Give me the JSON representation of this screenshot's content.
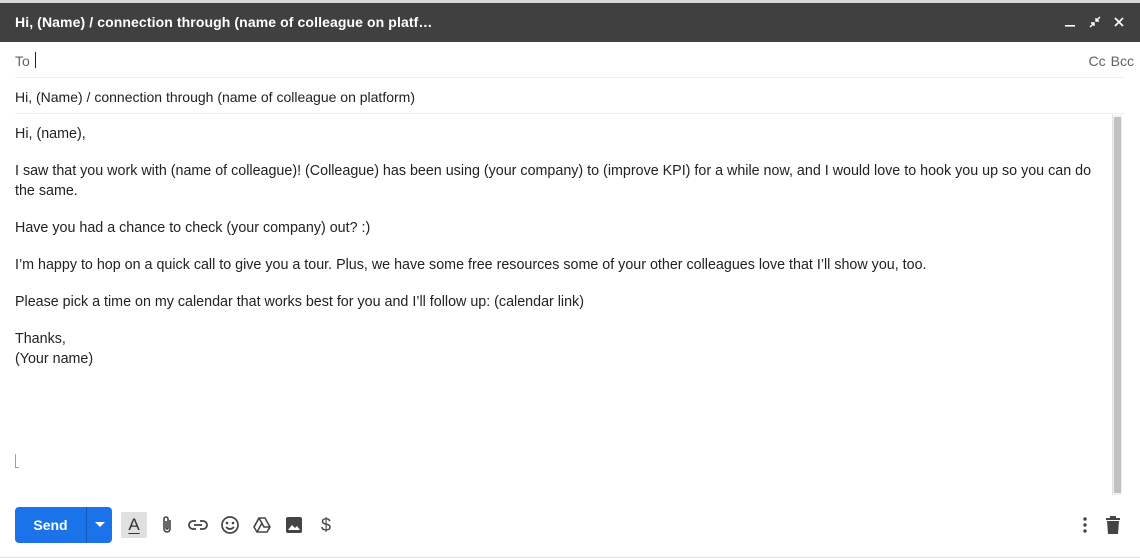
{
  "window": {
    "title": "Hi, (Name) / connection through (name of colleague on platf…",
    "minimize_icon": "minimize-icon",
    "expand_icon": "exit-fullscreen-icon",
    "close_icon": "close-icon"
  },
  "recipients": {
    "to_label": "To",
    "to_value": "",
    "cc_label": "Cc",
    "bcc_label": "Bcc"
  },
  "subject": "Hi, (Name) / connection through (name of colleague on platform)",
  "body": {
    "greeting": "Hi, (name),",
    "paragraph_1": "I saw that you work with (name of colleague)! (Colleague) has been using (your company) to (improve KPI) for a while now, and I would love to hook you up so you can do the same.",
    "paragraph_2": "Have you had a chance to check (your company) out? :)",
    "paragraph_3": "I’m happy to hop on a quick call to give you a tour. Plus, we have some free resources some of your other colleagues love that I’ll show you, too.",
    "paragraph_4": "Please pick a time on my calendar that works best for you and I’ll follow up: (calendar link)",
    "signoff": "Thanks,",
    "signature": "(Your name)"
  },
  "toolbar": {
    "send_label": "Send",
    "format_label": "A",
    "money_label": "$",
    "icons": [
      "send-options-icon",
      "formatting-options-icon",
      "attach-icon",
      "link-icon",
      "emoji-icon",
      "drive-icon",
      "photo-icon",
      "money-icon",
      "more-options-icon",
      "discard-draft-icon"
    ]
  }
}
